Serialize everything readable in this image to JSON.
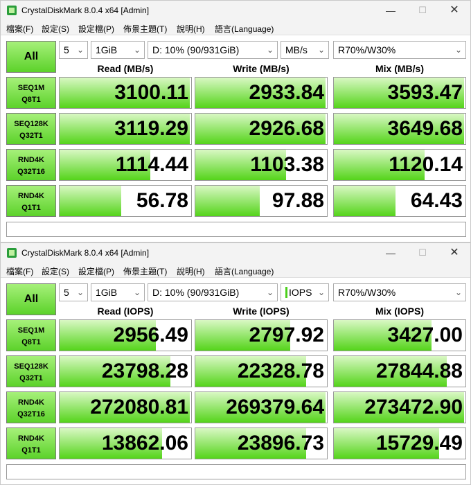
{
  "windows": [
    {
      "title": "CrystalDiskMark 8.0.4 x64 [Admin]",
      "menu": [
        "檔案(F)",
        "設定(S)",
        "設定檔(P)",
        "佈景主題(T)",
        "說明(H)",
        "語言(Language)"
      ],
      "all_label": "All",
      "count": "5",
      "size": "1GiB",
      "drive": "D: 10% (90/931GiB)",
      "unit": "MB/s",
      "mode": "R70%/W30%",
      "headers": [
        "Read (MB/s)",
        "Write (MB/s)",
        "Mix (MB/s)"
      ],
      "rows": [
        {
          "l1": "SEQ1M",
          "l2": "Q8T1",
          "values": [
            "3100.11",
            "2933.84",
            "3593.47"
          ],
          "fill": [
            0.99,
            0.99,
            0.99
          ]
        },
        {
          "l1": "SEQ128K",
          "l2": "Q32T1",
          "values": [
            "3119.29",
            "2926.68",
            "3649.68"
          ],
          "fill": [
            0.99,
            0.99,
            0.99
          ]
        },
        {
          "l1": "RND4K",
          "l2": "Q32T16",
          "values": [
            "1114.44",
            "1103.38",
            "1120.14"
          ],
          "fill": [
            0.69,
            0.69,
            0.69
          ]
        },
        {
          "l1": "RND4K",
          "l2": "Q1T1",
          "values": [
            "56.78",
            "97.88",
            "64.43"
          ],
          "fill": [
            0.47,
            0.49,
            0.47
          ]
        }
      ],
      "comment": ""
    },
    {
      "title": "CrystalDiskMark 8.0.4 x64 [Admin]",
      "menu": [
        "檔案(F)",
        "設定(S)",
        "設定檔(P)",
        "佈景主題(T)",
        "說明(H)",
        "語言(Language)"
      ],
      "all_label": "All",
      "count": "5",
      "size": "1GiB",
      "drive": "D: 10% (90/931GiB)",
      "unit": "IOPS",
      "mode": "R70%/W30%",
      "headers": [
        "Read (IOPS)",
        "Write (IOPS)",
        "Mix (IOPS)"
      ],
      "rows": [
        {
          "l1": "SEQ1M",
          "l2": "Q8T1",
          "values": [
            "2956.49",
            "2797.92",
            "3427.00"
          ],
          "fill": [
            0.73,
            0.72,
            0.74
          ]
        },
        {
          "l1": "SEQ128K",
          "l2": "Q32T1",
          "values": [
            "23798.28",
            "22328.78",
            "27844.88"
          ],
          "fill": [
            0.84,
            0.84,
            0.86
          ]
        },
        {
          "l1": "RND4K",
          "l2": "Q32T16",
          "values": [
            "272080.81",
            "269379.64",
            "273472.90"
          ],
          "fill": [
            0.99,
            0.99,
            0.99
          ]
        },
        {
          "l1": "RND4K",
          "l2": "Q1T1",
          "values": [
            "13862.06",
            "23896.73",
            "15729.49"
          ],
          "fill": [
            0.78,
            0.84,
            0.8
          ]
        }
      ],
      "comment": ""
    }
  ],
  "icons": {
    "app": "crystaldiskmark-icon",
    "minimize": "minimize-icon",
    "maximize": "maximize-icon",
    "close": "close-icon",
    "dropdown": "chevron-down-icon"
  },
  "colors": {
    "accent_green": "#5cd22a",
    "fill_green": "#54d41a",
    "titlebar": "#f3f3f3"
  }
}
